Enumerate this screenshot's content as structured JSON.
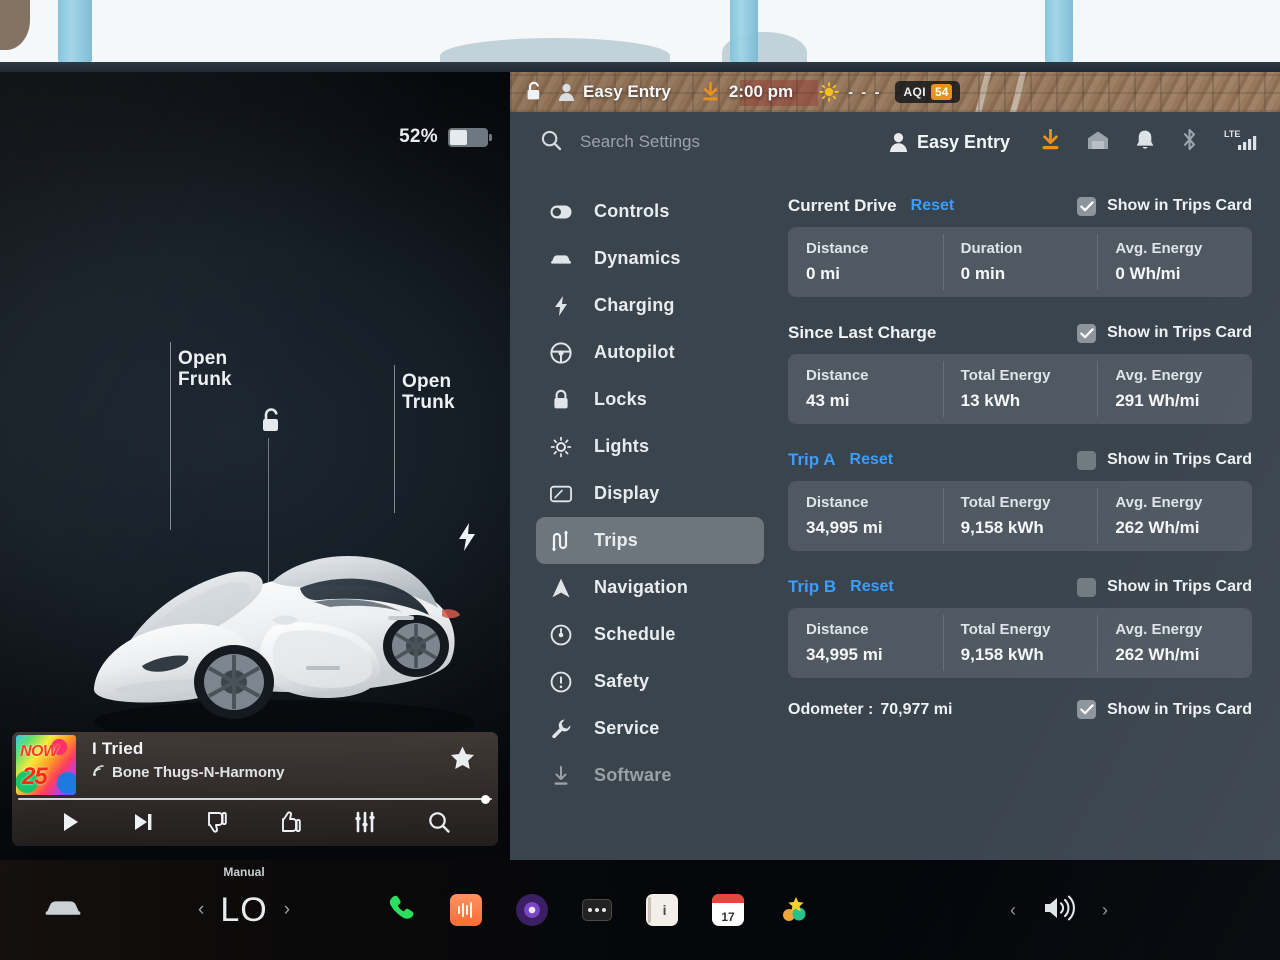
{
  "vehicle": {
    "battery_percent": "52%",
    "frunk_label_line1": "Open",
    "frunk_label_line2": "Frunk",
    "trunk_label_line1": "Open",
    "trunk_label_line2": "Trunk"
  },
  "media": {
    "title": "I Tried",
    "artist": "Bone Thugs-N-Harmony",
    "album_art_line1": "NOW",
    "album_art_line2": "25",
    "controls": [
      "play-icon",
      "next-track-icon",
      "thumbs-down-icon",
      "thumbs-up-icon",
      "equalizer-icon",
      "search-icon"
    ]
  },
  "map_strip": {
    "profile_name": "Easy Entry",
    "time": "2:00 pm",
    "weather_dashes": "- - -",
    "aqi_label": "AQI",
    "aqi_value": "54"
  },
  "topbar": {
    "search_placeholder": "Search Settings",
    "search_value": "",
    "profile_name": "Easy Entry",
    "icons": [
      "download-icon",
      "garage-icon",
      "bell-icon",
      "bluetooth-icon",
      "lte-signal-icon"
    ],
    "signal_label": "LTE"
  },
  "sidebar": {
    "items": [
      {
        "label": "Controls",
        "icon": "toggle-icon"
      },
      {
        "label": "Dynamics",
        "icon": "car-icon"
      },
      {
        "label": "Charging",
        "icon": "bolt-icon"
      },
      {
        "label": "Autopilot",
        "icon": "steering-wheel-icon"
      },
      {
        "label": "Locks",
        "icon": "lock-icon"
      },
      {
        "label": "Lights",
        "icon": "sun-icon"
      },
      {
        "label": "Display",
        "icon": "display-icon"
      },
      {
        "label": "Trips",
        "icon": "route-icon"
      },
      {
        "label": "Navigation",
        "icon": "navigation-arrow-icon"
      },
      {
        "label": "Schedule",
        "icon": "clock-icon"
      },
      {
        "label": "Safety",
        "icon": "exclamation-icon"
      },
      {
        "label": "Service",
        "icon": "wrench-icon"
      },
      {
        "label": "Software",
        "icon": "download-icon"
      }
    ],
    "active": "Trips"
  },
  "trips": {
    "checkbox_label": "Show in Trips Card",
    "reset_label": "Reset",
    "sections": [
      {
        "title": "Current Drive",
        "has_reset": true,
        "title_is_link": false,
        "checked": true,
        "stats": [
          {
            "label": "Distance",
            "value": "0 mi"
          },
          {
            "label": "Duration",
            "value": "0 min"
          },
          {
            "label": "Avg. Energy",
            "value": "0 Wh/mi"
          }
        ]
      },
      {
        "title": "Since Last Charge",
        "has_reset": false,
        "title_is_link": false,
        "checked": true,
        "stats": [
          {
            "label": "Distance",
            "value": "43 mi"
          },
          {
            "label": "Total Energy",
            "value": "13 kWh"
          },
          {
            "label": "Avg. Energy",
            "value": "291 Wh/mi"
          }
        ]
      },
      {
        "title": "Trip A",
        "has_reset": true,
        "title_is_link": true,
        "checked": false,
        "stats": [
          {
            "label": "Distance",
            "value": "34,995 mi"
          },
          {
            "label": "Total Energy",
            "value": "9,158 kWh"
          },
          {
            "label": "Avg. Energy",
            "value": "262 Wh/mi"
          }
        ]
      },
      {
        "title": "Trip B",
        "has_reset": true,
        "title_is_link": true,
        "checked": false,
        "stats": [
          {
            "label": "Distance",
            "value": "34,995 mi"
          },
          {
            "label": "Total Energy",
            "value": "9,158 kWh"
          },
          {
            "label": "Avg. Energy",
            "value": "262 Wh/mi"
          }
        ]
      }
    ],
    "odometer_label": "Odometer :",
    "odometer_value": "70,977 mi",
    "odometer_checked": true
  },
  "taskbar": {
    "climate_mode": "Manual",
    "climate_temp": "LO",
    "prev_arrow": "‹",
    "next_arrow": "›",
    "apps": [
      "phone-icon",
      "energy-icon",
      "theater-icon",
      "controls-dots-icon",
      "notes-icon",
      "calendar-icon",
      "toybox-icon"
    ],
    "calendar_day": "17",
    "volume_prev": "‹",
    "volume_next": "›"
  },
  "colors": {
    "accent_blue": "#3b9dff",
    "accent_orange": "#e8921c",
    "panel_bg": "#3a444d",
    "card_bg": "rgba(150,160,168,.24)"
  }
}
